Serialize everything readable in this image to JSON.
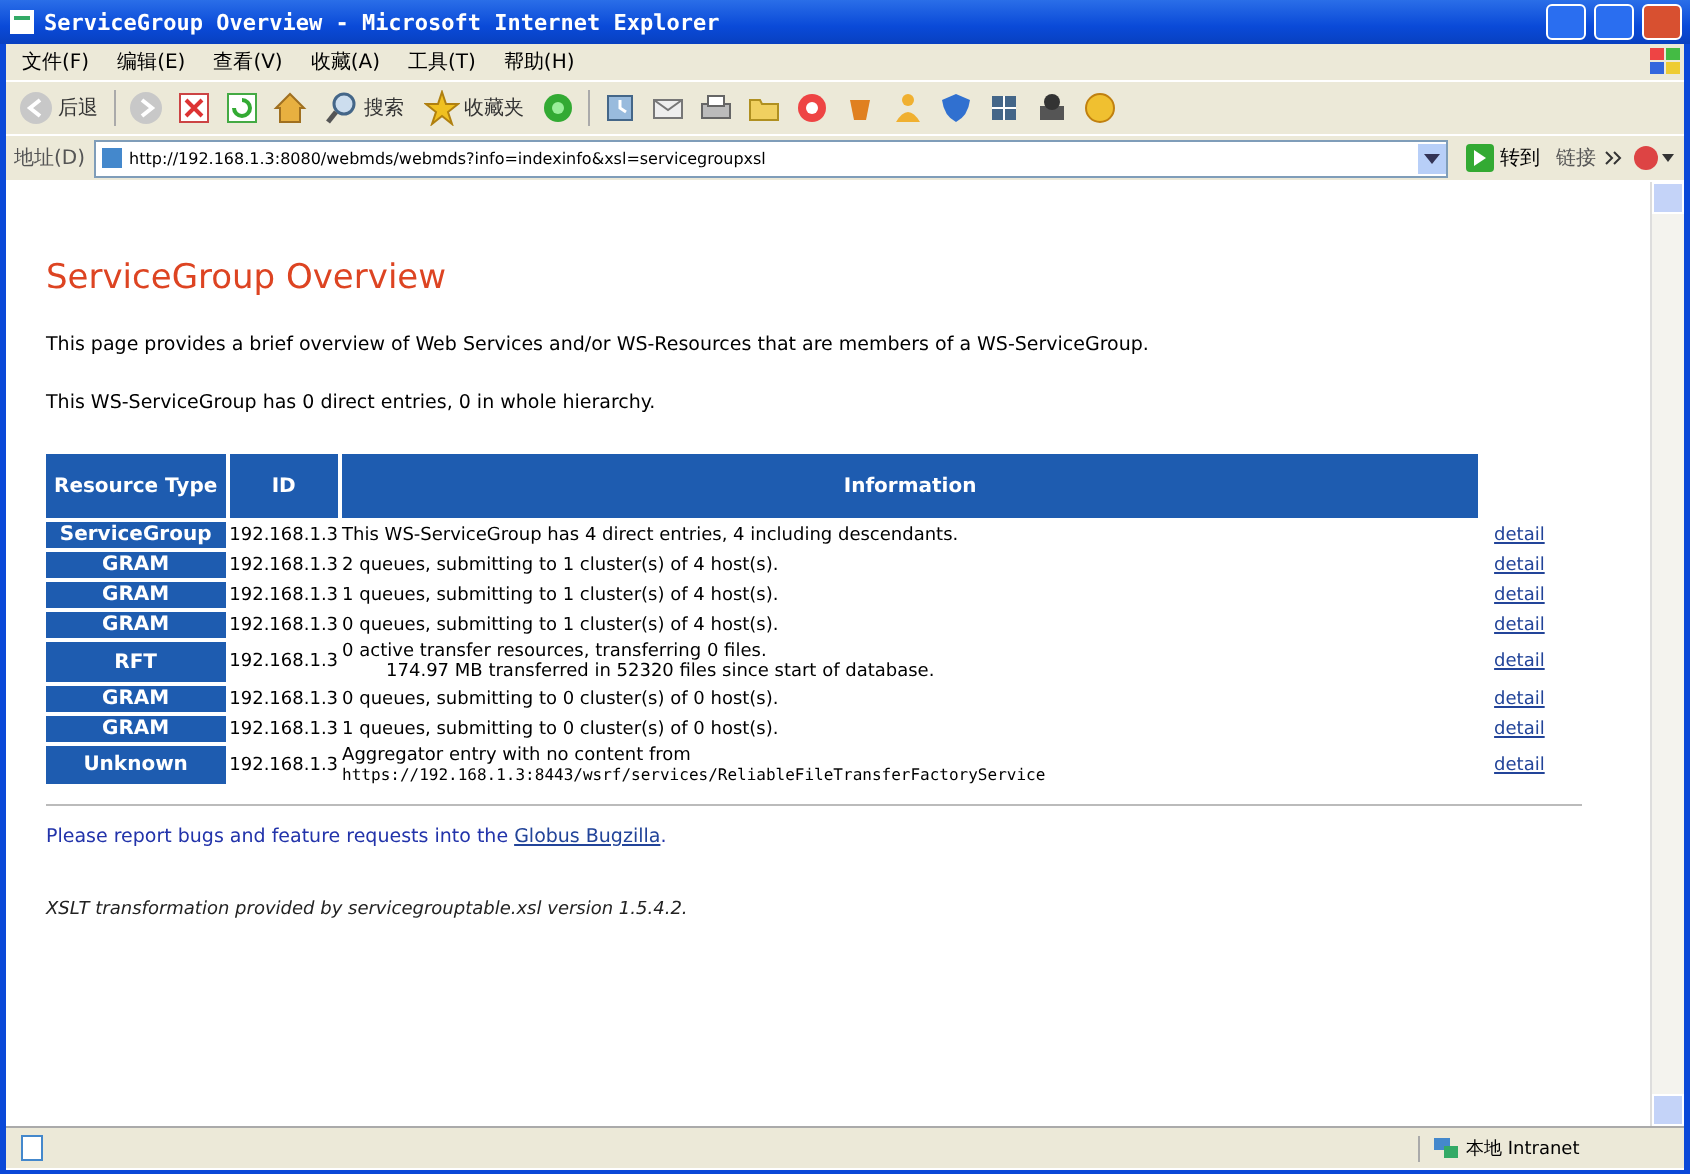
{
  "window": {
    "title": "ServiceGroup Overview - Microsoft Internet Explorer"
  },
  "menu": [
    "文件(F)",
    "编辑(E)",
    "查看(V)",
    "收藏(A)",
    "工具(T)",
    "帮助(H)"
  ],
  "toolbar": {
    "back": "后退",
    "search": "搜索",
    "favorites": "收藏夹"
  },
  "address": {
    "label": "地址(D)",
    "url": "http://192.168.1.3:8080/webmds/webmds?info=indexinfo&xsl=servicegroupxsl",
    "go": "转到",
    "links": "链接"
  },
  "page": {
    "heading": "ServiceGroup Overview",
    "intro": "This page provides a brief overview of Web Services and/or WS-Resources that are members of a WS-ServiceGroup.",
    "summary": "This WS-ServiceGroup has 0 direct entries, 0 in whole hierarchy.",
    "table": {
      "columns": [
        "Resource Type",
        "ID",
        "Information"
      ],
      "rows": [
        {
          "type": "ServiceGroup",
          "id": "192.168.1.3",
          "lines": [
            {
              "kind": "text",
              "text": "This WS-ServiceGroup has 4 direct entries, 4 including descendants."
            }
          ],
          "link": "detail"
        },
        {
          "type": "GRAM",
          "id": "192.168.1.3",
          "lines": [
            {
              "kind": "text",
              "text": "2 queues, submitting to 1 cluster(s) of 4 host(s)."
            }
          ],
          "link": "detail"
        },
        {
          "type": "GRAM",
          "id": "192.168.1.3",
          "lines": [
            {
              "kind": "text",
              "text": "1 queues, submitting to 1 cluster(s) of 4 host(s)."
            }
          ],
          "link": "detail"
        },
        {
          "type": "GRAM",
          "id": "192.168.1.3",
          "lines": [
            {
              "kind": "text",
              "text": "0 queues, submitting to 1 cluster(s) of 4 host(s)."
            }
          ],
          "link": "detail"
        },
        {
          "type": "RFT",
          "id": "192.168.1.3",
          "lines": [
            {
              "kind": "text",
              "text": "0 active transfer resources, transferring 0 files."
            },
            {
              "kind": "indented",
              "text": "174.97 MB transferred in 52320 files since start of database."
            }
          ],
          "link": "detail"
        },
        {
          "type": "GRAM",
          "id": "192.168.1.3",
          "lines": [
            {
              "kind": "text",
              "text": "0 queues, submitting to 0 cluster(s) of 0 host(s)."
            }
          ],
          "link": "detail"
        },
        {
          "type": "GRAM",
          "id": "192.168.1.3",
          "lines": [
            {
              "kind": "text",
              "text": "1 queues, submitting to 0 cluster(s) of 0 host(s)."
            }
          ],
          "link": "detail"
        },
        {
          "type": "Unknown",
          "id": "192.168.1.3",
          "lines": [
            {
              "kind": "text",
              "text": "Aggregator entry with no content from"
            },
            {
              "kind": "url",
              "text": "https://192.168.1.3:8443/wsrf/services/ReliableFileTransferFactoryService"
            }
          ],
          "link": "detail"
        }
      ]
    },
    "report": {
      "before": "Please report bugs and feature requests into the ",
      "link": "Globus Bugzilla",
      "after": "."
    },
    "note": "XSLT transformation provided by servicegrouptable.xsl version 1.5.4.2."
  },
  "status_bar": {
    "zone": "本地 Intranet"
  }
}
